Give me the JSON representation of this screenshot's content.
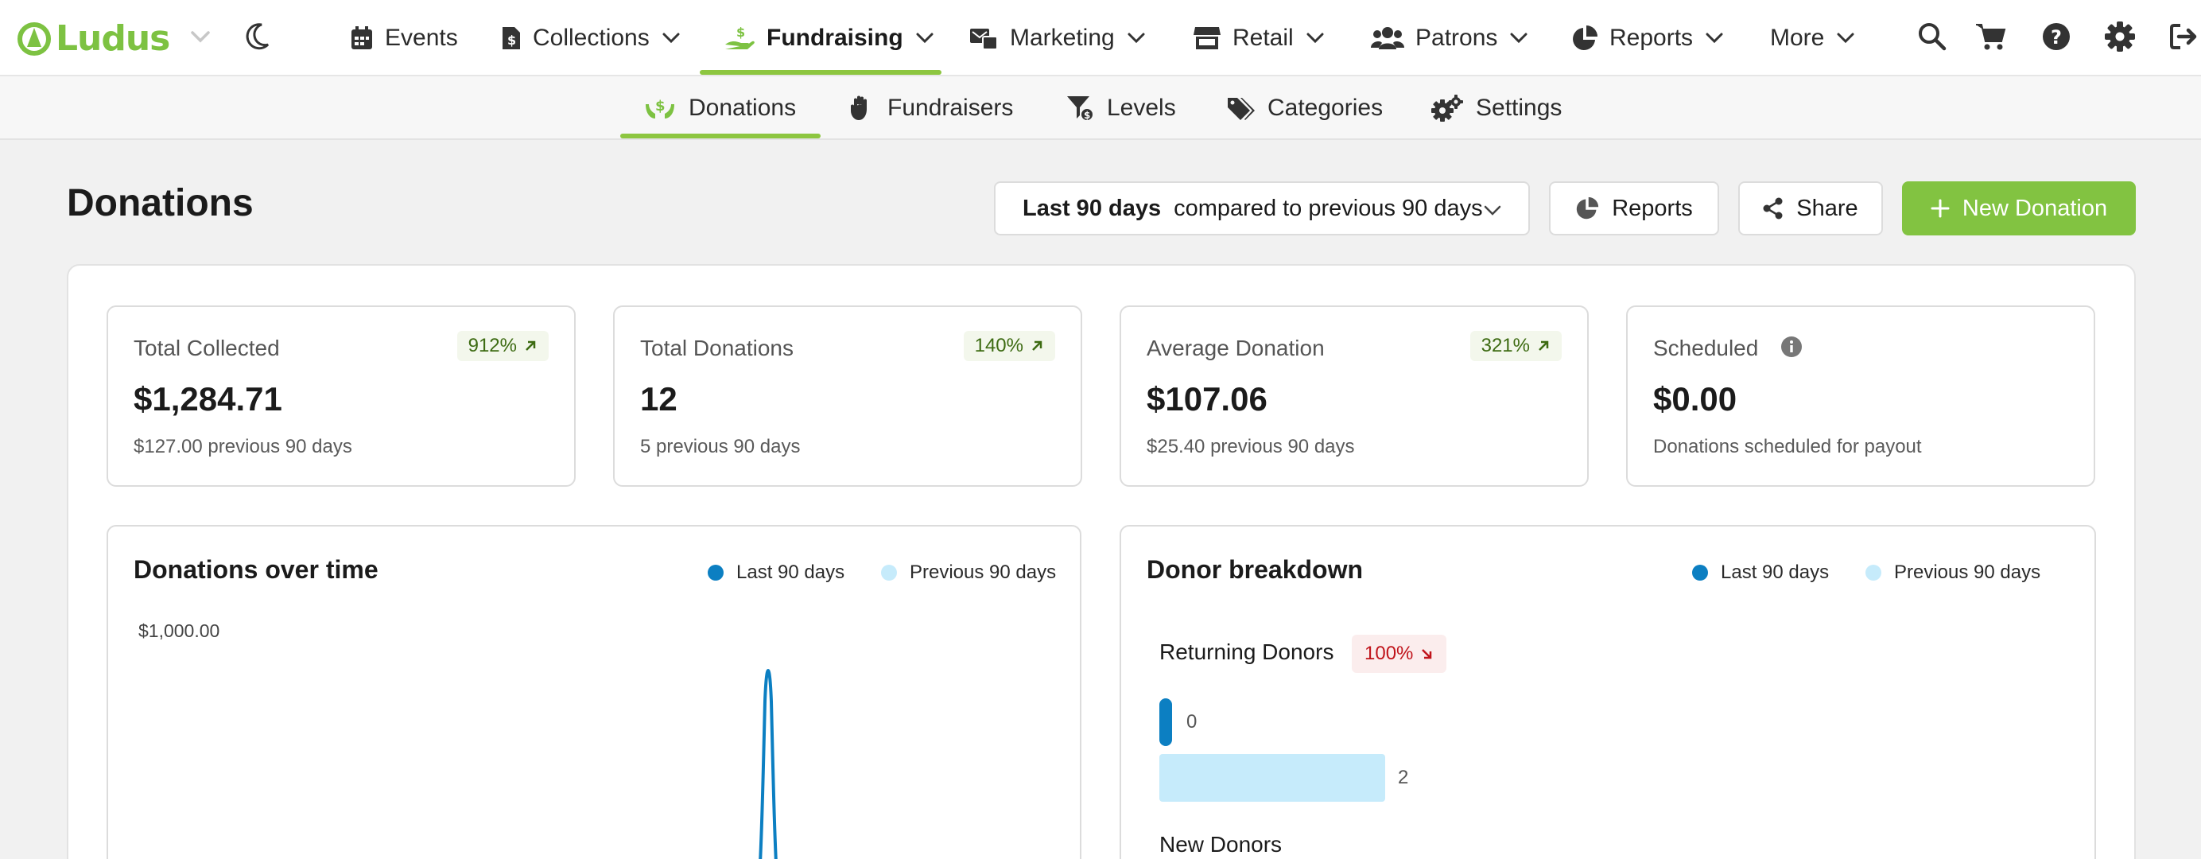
{
  "app": {
    "name": "Ludus"
  },
  "colors": {
    "brand_green": "#7dc242",
    "primary_button": "#82c341",
    "series_current": "#0c7fc2",
    "series_previous": "#c6ebfb",
    "badge_up_text": "#3d6b12",
    "badge_down_text": "#c0141b"
  },
  "nav": {
    "items": [
      {
        "label": "Events",
        "icon": "calendar-icon"
      },
      {
        "label": "Collections",
        "icon": "collections-icon"
      },
      {
        "label": "Fundraising",
        "icon": "hand-coin-icon",
        "active": true
      },
      {
        "label": "Marketing",
        "icon": "marketing-icon"
      },
      {
        "label": "Retail",
        "icon": "store-icon"
      },
      {
        "label": "Patrons",
        "icon": "users-icon"
      },
      {
        "label": "Reports",
        "icon": "pie-chart-icon"
      },
      {
        "label": "More"
      }
    ],
    "icons": [
      "search-icon",
      "cart-icon",
      "help-icon",
      "gear-icon",
      "logout-icon"
    ]
  },
  "subnav": {
    "items": [
      {
        "label": "Donations",
        "icon": "donations-icon",
        "active": true
      },
      {
        "label": "Fundraisers",
        "icon": "hand-icon"
      },
      {
        "label": "Levels",
        "icon": "levels-icon"
      },
      {
        "label": "Categories",
        "icon": "tags-icon"
      },
      {
        "label": "Settings",
        "icon": "gears-icon"
      }
    ]
  },
  "page": {
    "title": "Donations",
    "range_strong": "Last 90 days",
    "range_rest": "compared to previous 90 days",
    "reports_label": "Reports",
    "share_label": "Share",
    "new_label": "New Donation"
  },
  "stats": [
    {
      "label": "Total Collected",
      "value": "$1,284.71",
      "badge": "912%",
      "sub": "$127.00 previous 90 days"
    },
    {
      "label": "Total Donations",
      "value": "12",
      "badge": "140%",
      "sub": "5 previous 90 days"
    },
    {
      "label": "Average Donation",
      "value": "$107.06",
      "badge": "321%",
      "sub": "$25.40 previous 90 days"
    },
    {
      "label": "Scheduled",
      "value": "$0.00",
      "sub": "Donations scheduled for payout"
    }
  ],
  "over_time": {
    "title": "Donations over time",
    "legend_current": "Last 90 days",
    "legend_previous": "Previous 90 days",
    "y_label": "$1,000.00"
  },
  "donor": {
    "title": "Donor breakdown",
    "legend_current": "Last 90 days",
    "legend_previous": "Previous 90 days",
    "returning_label": "Returning Donors",
    "returning_badge": "100%",
    "returning_current": "0",
    "returning_previous": "2",
    "new_label": "New Donors"
  }
}
